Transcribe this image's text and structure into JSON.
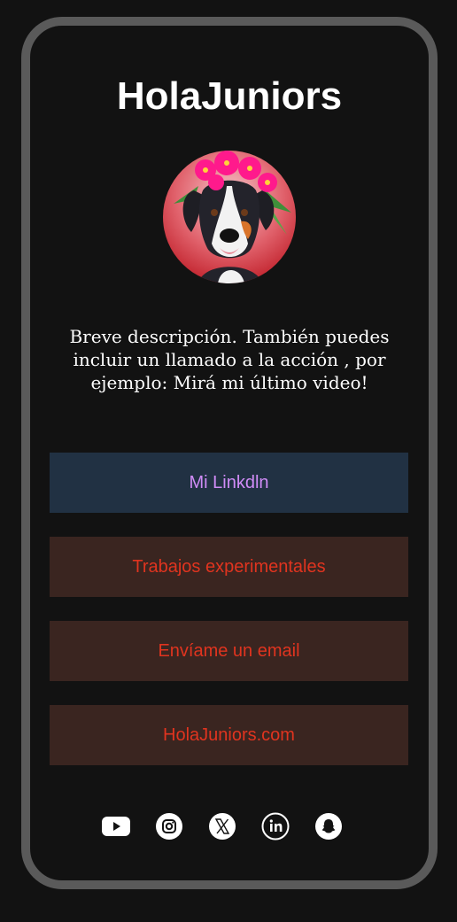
{
  "profile": {
    "title": "HolaJuniors",
    "avatar_alt": "dog with pink flower crown",
    "description": "Breve descripción. También puedes incluir un llamado a la acción , por ejemplo: Mirá mi último video!"
  },
  "links": {
    "linkedin": "Mi Linkdln",
    "trabajos": "Trabajos experimentales",
    "email": "Envíame un email",
    "site": "HolaJuniors.com"
  },
  "colors": {
    "background": "#121212",
    "frame": "#5a5a5a",
    "linkedin_bg": "#213143",
    "linkedin_text": "#d08cf7",
    "link_bg": "#3a2520",
    "link_text": "#e0341f"
  },
  "socials": [
    "youtube-icon",
    "instagram-icon",
    "x-icon",
    "linkedin-icon",
    "snapchat-icon"
  ]
}
